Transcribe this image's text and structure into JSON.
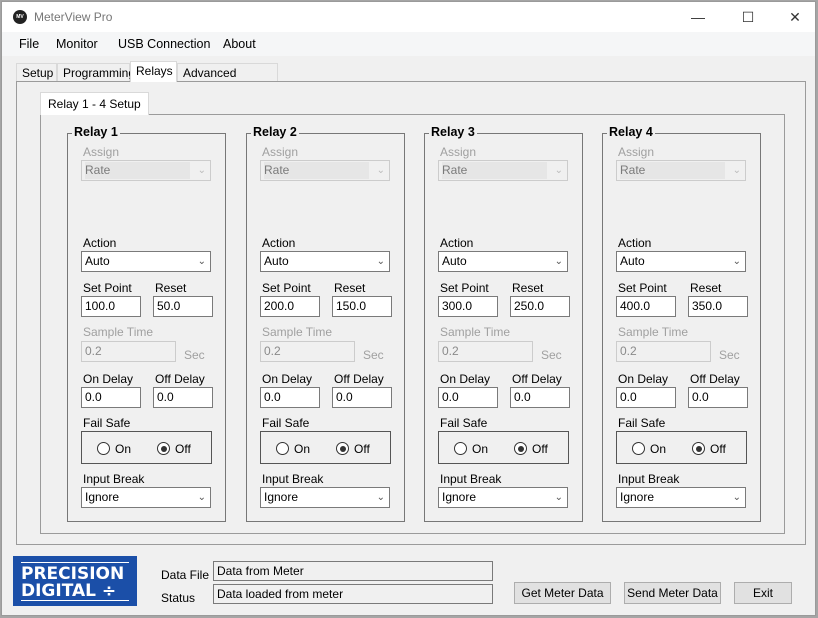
{
  "window": {
    "title": "MeterView Pro",
    "app_icon_text": "MV PRO",
    "minimize_glyph": "—",
    "maximize_glyph": "☐",
    "close_glyph": "✕"
  },
  "menu": [
    "File",
    "Monitor",
    "USB Connection",
    "About"
  ],
  "tabs": [
    "Setup",
    "Programming",
    "Relays",
    "Advanced Features"
  ],
  "active_tab": "Relays",
  "inner_tab": "Relay 1 - 4 Setup",
  "labels": {
    "assign": "Assign",
    "action": "Action",
    "set_point": "Set Point",
    "reset": "Reset",
    "sample_time": "Sample Time",
    "sec": "Sec",
    "on_delay": "On Delay",
    "off_delay": "Off Delay",
    "fail_safe": "Fail Safe",
    "on": "On",
    "off": "Off",
    "input_break": "Input Break"
  },
  "relays": [
    {
      "title": "Relay 1",
      "assign": "Rate",
      "action": "Auto",
      "set_point": "100.0",
      "reset": "50.0",
      "sample_time": "0.2",
      "on_delay": "0.0",
      "off_delay": "0.0",
      "fail_safe": "Off",
      "input_break": "Ignore"
    },
    {
      "title": "Relay 2",
      "assign": "Rate",
      "action": "Auto",
      "set_point": "200.0",
      "reset": "150.0",
      "sample_time": "0.2",
      "on_delay": "0.0",
      "off_delay": "0.0",
      "fail_safe": "Off",
      "input_break": "Ignore"
    },
    {
      "title": "Relay 3",
      "assign": "Rate",
      "action": "Auto",
      "set_point": "300.0",
      "reset": "250.0",
      "sample_time": "0.2",
      "on_delay": "0.0",
      "off_delay": "0.0",
      "fail_safe": "Off",
      "input_break": "Ignore"
    },
    {
      "title": "Relay 4",
      "assign": "Rate",
      "action": "Auto",
      "set_point": "400.0",
      "reset": "350.0",
      "sample_time": "0.2",
      "on_delay": "0.0",
      "off_delay": "0.0",
      "fail_safe": "Off",
      "input_break": "Ignore"
    }
  ],
  "logo": {
    "line1": "PRECISION",
    "line2": "DIGITAL ÷",
    "color": "#1b4fa8"
  },
  "footer": {
    "data_file_label": "Data File",
    "data_file_value": "Data from Meter",
    "status_label": "Status",
    "status_value": "Data loaded from meter",
    "buttons": [
      "Get Meter Data",
      "Send Meter Data",
      "Exit"
    ]
  }
}
